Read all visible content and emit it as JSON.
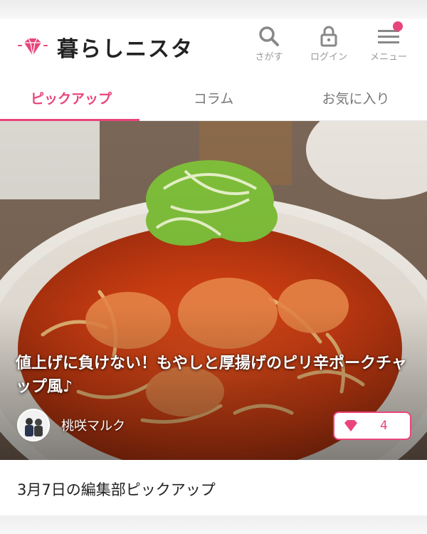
{
  "brand": {
    "name": "暮らしニスタ",
    "accent": "#e8457a"
  },
  "header": {
    "search_label": "さがす",
    "login_label": "ログイン",
    "menu_label": "メニュー"
  },
  "tabs": [
    {
      "label": "ピックアップ",
      "active": true
    },
    {
      "label": "コラム",
      "active": false
    },
    {
      "label": "お気に入り",
      "active": false
    }
  ],
  "feature": {
    "title": "値上げに負けない！もやしと厚揚げのピリ辛ポークチャップ風♪",
    "author": "桃咲マルク",
    "likes": "4"
  },
  "section": {
    "title": "3月7日の編集部ピックアップ"
  },
  "icons": [
    "diamond-icon",
    "search-icon",
    "lock-icon",
    "hamburger-icon",
    "avatar-image"
  ]
}
